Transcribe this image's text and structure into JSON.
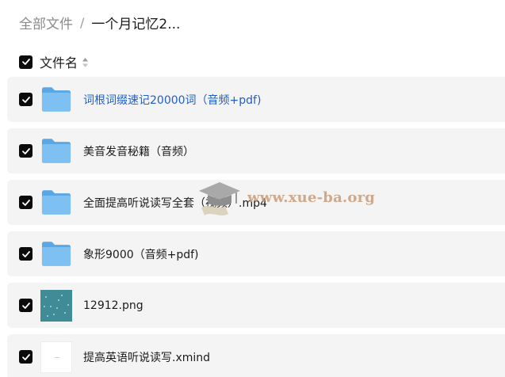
{
  "breadcrumb": {
    "root": "全部文件",
    "separator": "/",
    "current": "一个月记忆2..."
  },
  "list_header": {
    "label": "文件名",
    "checked": true,
    "sort_icon": "sort-icon"
  },
  "files": [
    {
      "name": "词根词缀速记20000词（音频+pdf)",
      "type": "folder",
      "checked": true,
      "highlighted": true
    },
    {
      "name": "美音发音秘籍（音频）",
      "type": "folder",
      "checked": true,
      "highlighted": false
    },
    {
      "name": "全面提高听说读写全套（视频）.mp4",
      "type": "folder",
      "checked": true,
      "highlighted": false
    },
    {
      "name": "象形9000（音频+pdf)",
      "type": "folder",
      "checked": true,
      "highlighted": false
    },
    {
      "name": "12912.png",
      "type": "image",
      "checked": true,
      "highlighted": false
    },
    {
      "name": "提高英语听说读写.xmind",
      "type": "document",
      "checked": true,
      "highlighted": false
    }
  ],
  "watermark": {
    "text": "www.xue-ba.org",
    "icon": "graduation-cap-icon"
  },
  "colors": {
    "link": "#1f5fc8",
    "row_bg": "#f4f4f4",
    "folder": "#6fb6ec",
    "checkbox": "#0b0b0b"
  }
}
